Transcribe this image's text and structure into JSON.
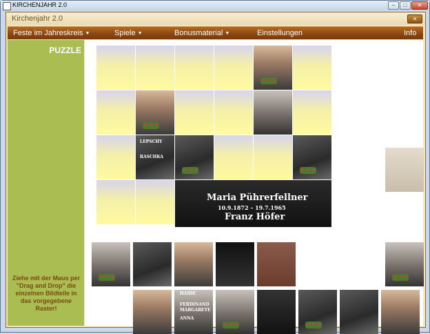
{
  "window": {
    "title": "KIRCHENJAHR 2.0",
    "controls": {
      "minimize": "–",
      "maximize": "□",
      "close": "✕"
    }
  },
  "app": {
    "title": "Kirchenjahr 2.0",
    "close_label": "✕"
  },
  "menu": {
    "items": [
      {
        "label": "Feste im Jahreskreis",
        "dropdown": true
      },
      {
        "label": "Spiele",
        "dropdown": true
      },
      {
        "label": "Bonusmaterial",
        "dropdown": true
      },
      {
        "label": "Einstellungen",
        "dropdown": false
      },
      {
        "label": "Info",
        "dropdown": false
      }
    ]
  },
  "sidebar": {
    "title": "PUZZLE",
    "instruction": "Ziehe mit der Maus per \"Drag and Drop\" die einzelnen Bildteile in das vorgegebene Raster!"
  },
  "puzzle": {
    "inscription_line1": "Maria Pührerfellner",
    "inscription_line2": "10.9.1872 – 19.7.1965",
    "inscription_line3": "Franz Höfer",
    "piece_texts": [
      "FERDINAND",
      "MARGARETE",
      "ANNA",
      "LEPSCHY",
      "RASCHKA",
      "HAIDE"
    ]
  },
  "colors": {
    "menu_bar": "#8a4510",
    "sidebar": "#a9bd53",
    "sidebar_title": "#ffffff",
    "hint_text": "#7a4a10",
    "empty_cell_top": "#d8d4ee",
    "empty_cell_bottom": "#fffaa0"
  }
}
